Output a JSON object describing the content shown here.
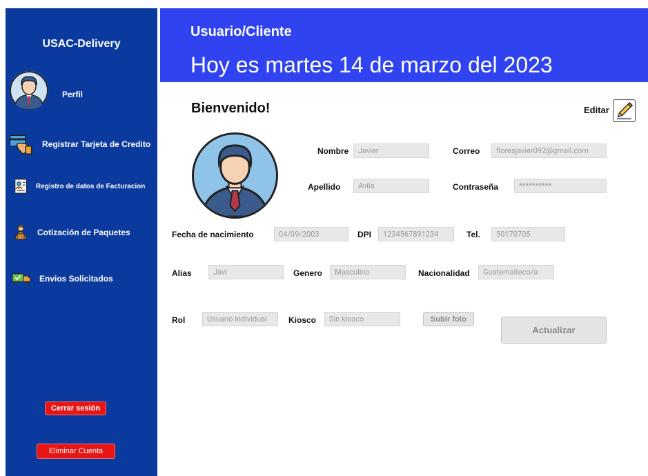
{
  "sidebar": {
    "app_title": "USAC-Delivery",
    "profile_label": "Perfil",
    "items": [
      {
        "label": "Registrar Tarjeta de Credito",
        "icon": "credit-card-icon"
      },
      {
        "label": "Registro de datos de Facturacion",
        "icon": "invoice-icon"
      },
      {
        "label": "Cotización de Paquetes",
        "icon": "courier-icon"
      },
      {
        "label": "Envios Solicitados",
        "icon": "delivery-truck-icon"
      }
    ],
    "logout_label": "Cerrar sesión",
    "delete_account_label": "Eliminar Cuenta"
  },
  "header": {
    "role": "Usuario/Cliente",
    "date": "Hoy es martes 14 de marzo del 2023"
  },
  "main": {
    "welcome": "Bienvenido!",
    "edit_label": "Editar",
    "fields": {
      "nombre": {
        "label": "Nombre",
        "value": "Javier"
      },
      "correo": {
        "label": "Correo",
        "value": "floresjavier092@gmail.com"
      },
      "apellido": {
        "label": "Apellido",
        "value": "Avila"
      },
      "contrasena": {
        "label": "Contraseña",
        "value": "**********"
      },
      "fecha": {
        "label": "Fecha de nacimiento",
        "value": "04/09/2003"
      },
      "dpi": {
        "label": "DPI",
        "value": "1234567891234"
      },
      "tel": {
        "label": "Tel.",
        "value": "50170705"
      },
      "alias": {
        "label": "Alias",
        "value": "Javi"
      },
      "genero": {
        "label": "Genero",
        "value": "Masculino"
      },
      "nacionalidad": {
        "label": "Nacionalidad",
        "value": "Guatemalteco/a"
      },
      "rol": {
        "label": "Rol",
        "value": "Usuario individual"
      },
      "kiosco": {
        "label": "Kiosco",
        "value": "Sin kiosco"
      }
    },
    "upload_photo_label": "Subir foto",
    "update_label": "Actualizar"
  },
  "colors": {
    "sidebar_bg": "#0b3a9e",
    "header_bg": "#3043f0",
    "danger": "#e81515"
  }
}
